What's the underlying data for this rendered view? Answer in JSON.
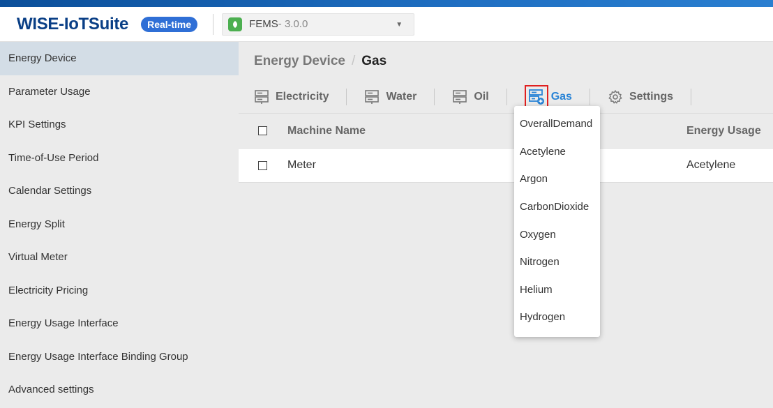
{
  "header": {
    "logo": "WISE-IoTSuite",
    "badge": "Real-time",
    "app_name": "FEMS",
    "app_version": " - 3.0.0",
    "app_icon": "energy-app-icon"
  },
  "sidebar": {
    "items": [
      {
        "label": "Energy Device",
        "active": true
      },
      {
        "label": "Parameter Usage"
      },
      {
        "label": "KPI Settings"
      },
      {
        "label": "Time-of-Use Period"
      },
      {
        "label": "Calendar Settings"
      },
      {
        "label": "Energy Split"
      },
      {
        "label": "Virtual Meter"
      },
      {
        "label": "Electricity Pricing"
      },
      {
        "label": "Energy Usage Interface"
      },
      {
        "label": "Energy Usage Interface Binding Group"
      },
      {
        "label": "Advanced settings"
      }
    ]
  },
  "breadcrumb": {
    "parent": "Energy Device",
    "separator": "/",
    "current": "Gas"
  },
  "tabs": [
    {
      "label": "Electricity",
      "icon": "server-icon"
    },
    {
      "label": "Water",
      "icon": "server-icon"
    },
    {
      "label": "Oil",
      "icon": "server-icon"
    },
    {
      "label": "Gas",
      "icon": "server-add-icon",
      "active": true
    },
    {
      "label": "Settings",
      "icon": "gear-icon"
    }
  ],
  "table": {
    "columns": [
      "Machine Name",
      "Energy Usage"
    ],
    "rows": [
      {
        "name": "Meter",
        "usage": "Acetylene"
      }
    ]
  },
  "dropdown": {
    "items": [
      "OverallDemand",
      "Acetylene",
      "Argon",
      "CarbonDioxide",
      "Oxygen",
      "Nitrogen",
      "Helium",
      "Hydrogen"
    ]
  },
  "colors": {
    "accent": "#2a84d6",
    "brand": "#0a3f86",
    "badge": "#2f6fd6",
    "highlight": "#e02020"
  }
}
